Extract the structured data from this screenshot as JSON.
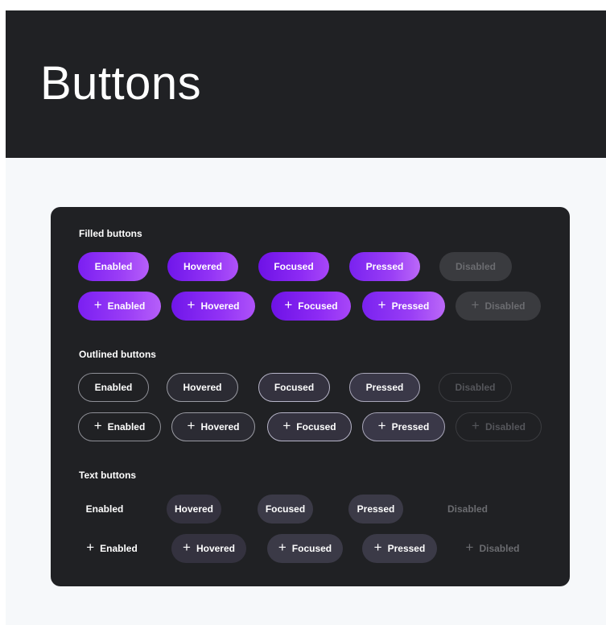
{
  "header": {
    "title": "Buttons"
  },
  "icons": {
    "plus": "+"
  },
  "sections": {
    "filled": {
      "title": "Filled buttons",
      "labels": [
        "Enabled",
        "Hovered",
        "Focused",
        "Pressed",
        "Disabled"
      ]
    },
    "outlined": {
      "title": "Outlined buttons",
      "labels": [
        "Enabled",
        "Hovered",
        "Focused",
        "Pressed",
        "Disabled"
      ]
    },
    "text": {
      "title": "Text buttons",
      "labels": [
        "Enabled",
        "Hovered",
        "Focused",
        "Pressed",
        "Disabled"
      ]
    }
  },
  "colors": {
    "header_bg": "#202124",
    "panel_bg": "#202124",
    "accent_start": "#7b1ff2",
    "accent_end": "#b65ff9",
    "disabled_bg": "#3a3b3f"
  }
}
